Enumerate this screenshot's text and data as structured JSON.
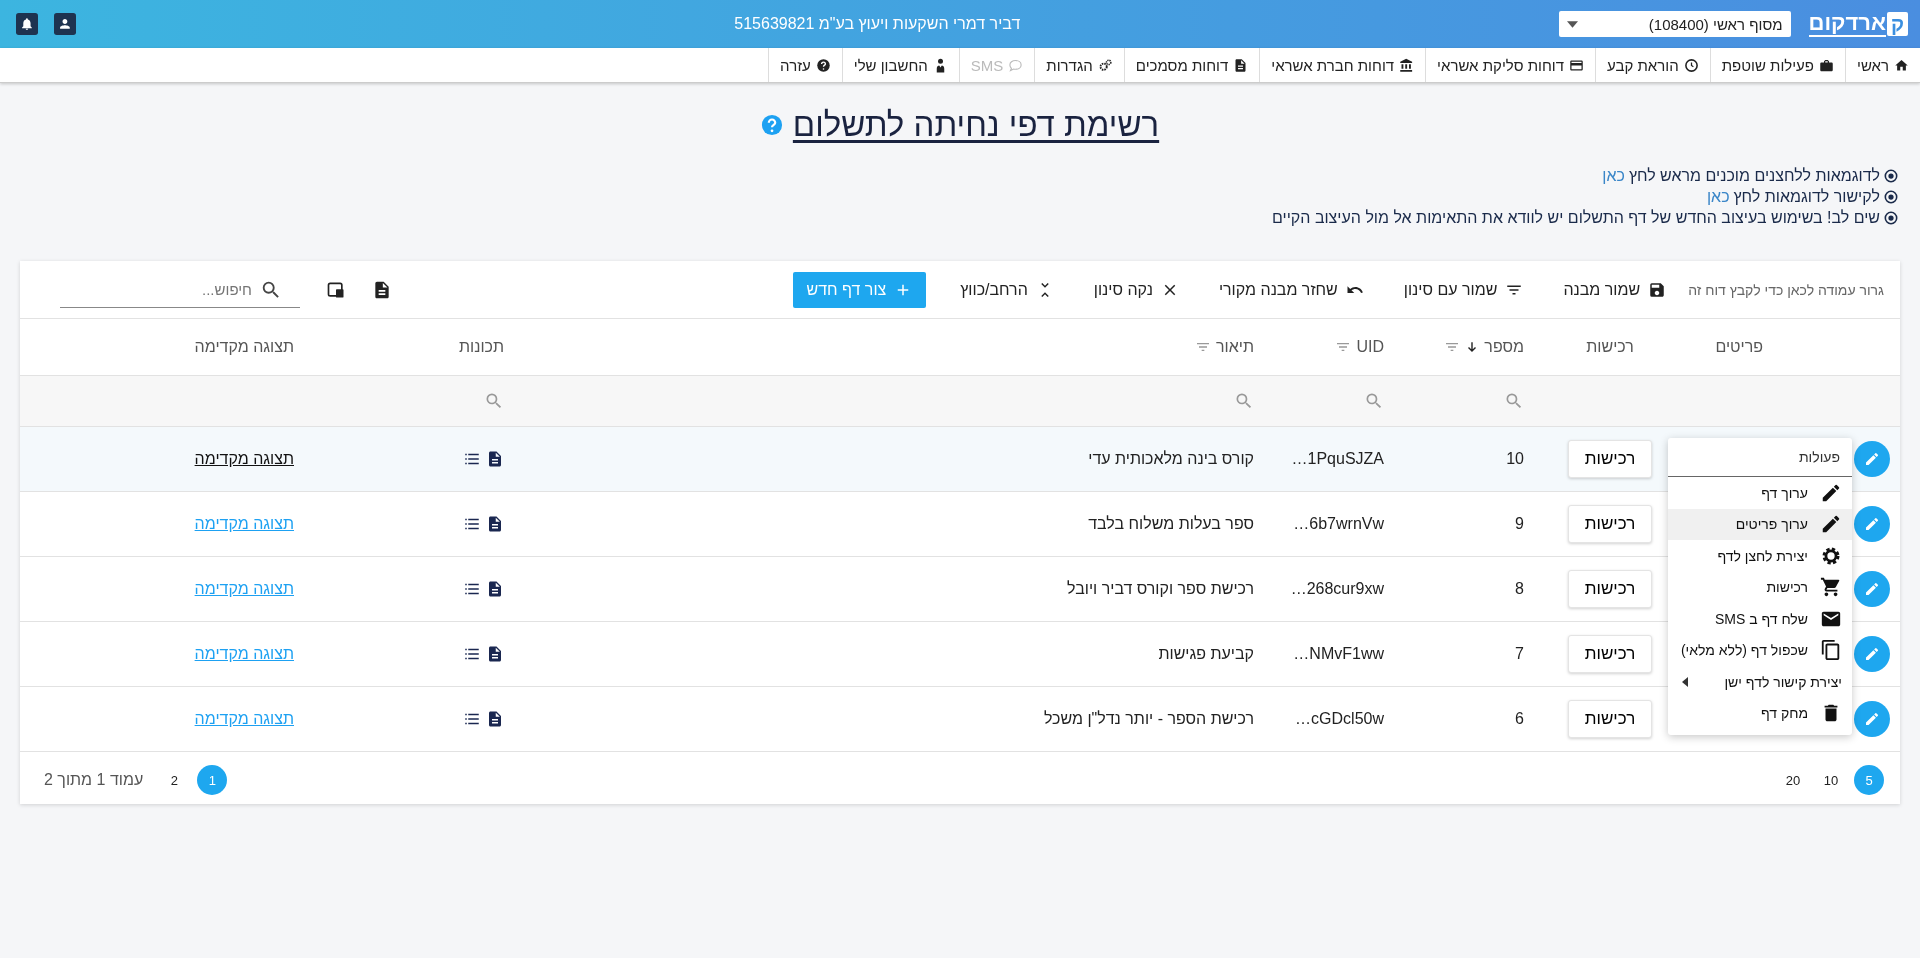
{
  "top_bar": {
    "logo_mark": "ק",
    "logo_text": "ארדקום",
    "terminal_select": "מסוף ראשי (108400)",
    "company": "דביר דמרי השקעות ויעוץ בע\"מ 515639821"
  },
  "nav": [
    {
      "label": "ראשי",
      "disabled": false
    },
    {
      "label": "פעילות שוטפת",
      "disabled": false
    },
    {
      "label": "הוראת קבע",
      "disabled": false
    },
    {
      "label": "דוחות סליקת אשראי",
      "disabled": false
    },
    {
      "label": "דוחות חברת אשראי",
      "disabled": false
    },
    {
      "label": "דוחות מסמכים",
      "disabled": false
    },
    {
      "label": "הגדרות",
      "disabled": false
    },
    {
      "label": "SMS",
      "disabled": true
    },
    {
      "label": "החשבון שלי",
      "disabled": false
    },
    {
      "label": "עזרה",
      "disabled": false
    }
  ],
  "page_title": "רשימת דפי נחיתה לתשלום",
  "notes": [
    {
      "text": "לדוגמאות ללחצנים מוכנים מראש לחץ",
      "link": "כאן"
    },
    {
      "text": "לקישור לדוגמאות לחץ",
      "link": "כאן"
    },
    {
      "text": "שים לב! בשימוש בעיצוב החדש של דף התשלום יש לוודא את התאימות אל מול העיצוב הקיים"
    }
  ],
  "toolbar": {
    "group_hint": "גרור עמודה לכאן כדי לקבץ דוח זה",
    "actions": [
      "שמור מבנה",
      "שמור עם סינון",
      "שחזר מבנה מקורי",
      "נקה סינון",
      "הרחב/כווץ"
    ],
    "new_button": "צור דף חדש",
    "search_placeholder": "חיפוש..."
  },
  "columns": [
    {
      "label": "פריטים",
      "sorted_desc": false,
      "filter": false,
      "searchable": false
    },
    {
      "label": "רכישות",
      "sorted_desc": false,
      "filter": false,
      "searchable": false
    },
    {
      "label": "מספר",
      "sorted_desc": true,
      "filter": true,
      "searchable": true
    },
    {
      "label": "UID",
      "sorted_desc": false,
      "filter": true,
      "searchable": true
    },
    {
      "label": "תיאור",
      "sorted_desc": false,
      "filter": true,
      "searchable": true
    },
    {
      "label": "תכונות",
      "sorted_desc": false,
      "filter": false,
      "searchable": true
    },
    {
      "label": "תצוגה מקדימה",
      "sorted_desc": false,
      "filter": false,
      "searchable": false
    }
  ],
  "rows": [
    {
      "highlighted": true,
      "purchases": "רכישות",
      "number": "10",
      "uid": "…1PquSJZA",
      "description": "קורס בינה מלאכותית עדי",
      "preview": "תצוגה מקדימה"
    },
    {
      "highlighted": false,
      "purchases": "רכישות",
      "number": "9",
      "uid": "…6b7wrnVw",
      "description": "ספר בעלות משלוח בלבד",
      "preview": "תצוגה מקדימה"
    },
    {
      "highlighted": false,
      "purchases": "רכישות",
      "number": "8",
      "uid": "…268cur9xw",
      "description": "רכישת ספר וקורס דביר ויובל",
      "preview": "תצוגה מקדימה"
    },
    {
      "highlighted": false,
      "purchases": "רכישות",
      "number": "7",
      "uid": "…NMvF1ww",
      "description": "קביעת פגישות",
      "preview": "תצוגה מקדימה"
    },
    {
      "highlighted": false,
      "purchases": "רכישות",
      "number": "6",
      "uid": "…cGDcl50w",
      "description": "רכישת הספר - יותר נדל\"ן משכל",
      "preview": "תצוגה מקדימה"
    }
  ],
  "actions_menu": {
    "title": "פעולות",
    "items": [
      {
        "label": "ערוך דף",
        "highlighted": false,
        "submenu": false
      },
      {
        "label": "ערוך פריטים",
        "highlighted": true,
        "submenu": false
      },
      {
        "label": "יצירת לחצן לדף",
        "highlighted": false,
        "submenu": false
      },
      {
        "label": "רכישות",
        "highlighted": false,
        "submenu": false
      },
      {
        "label": "שלח דף ב SMS",
        "highlighted": false,
        "submenu": false
      },
      {
        "label": "שכפול דף (ללא מלאי)",
        "highlighted": false,
        "submenu": false
      },
      {
        "label": "יצירת קישור לדף ישן",
        "highlighted": false,
        "submenu": true
      },
      {
        "label": "מחק דף",
        "highlighted": false,
        "submenu": false
      }
    ]
  },
  "pagination": {
    "page_sizes": [
      {
        "label": "5",
        "selected": true
      },
      {
        "label": "10",
        "selected": false
      },
      {
        "label": "20",
        "selected": false
      }
    ],
    "pages": [
      {
        "label": "1",
        "selected": true
      },
      {
        "label": "2",
        "selected": false
      }
    ],
    "page_info": "עמוד 1 מתוך 2"
  }
}
